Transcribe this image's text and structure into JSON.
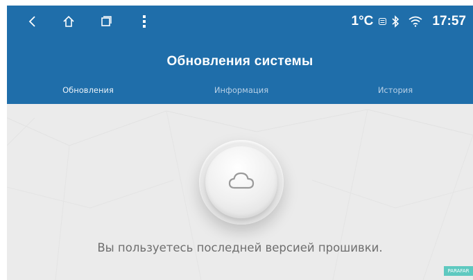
{
  "status_bar": {
    "nav_icons": [
      "back-icon",
      "home-icon",
      "recents-icon",
      "more-vert-icon"
    ],
    "temperature": "1°C",
    "weather_icon": "weather-icon",
    "bluetooth_icon": "bluetooth-icon",
    "wifi_icon": "wifi-icon",
    "time": "17:57"
  },
  "header": {
    "title": "Обновления системы"
  },
  "tabs": [
    {
      "label": "Обновления",
      "active": true
    },
    {
      "label": "Информация",
      "active": false
    },
    {
      "label": "История",
      "active": false
    }
  ],
  "main": {
    "cloud_icon": "cloud-icon",
    "message": "Вы пользуетесь последней версией прошивки."
  },
  "watermark": {
    "text": "PARAFAR"
  },
  "colors": {
    "header_blue": "#1f6eaa",
    "content_background": "#ebebeb",
    "message_text": "#6e6e6e"
  }
}
